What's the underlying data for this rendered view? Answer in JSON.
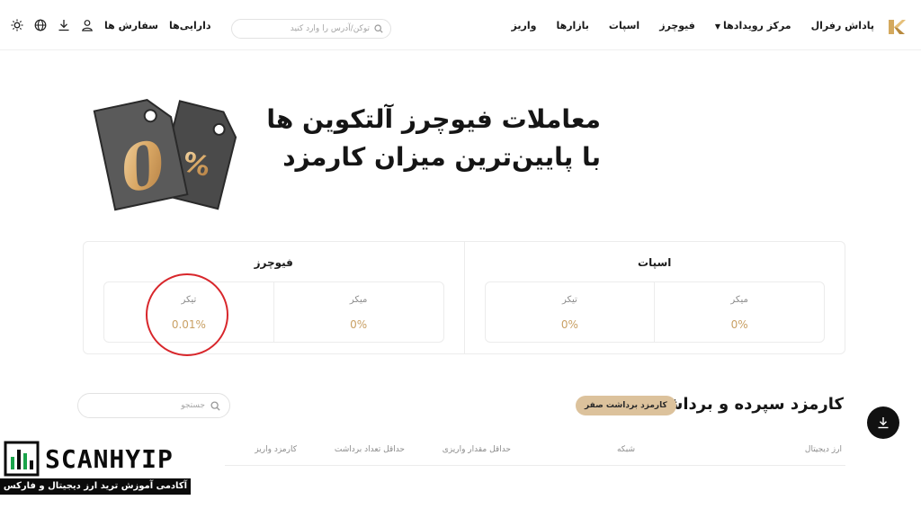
{
  "header": {
    "logo_icon": "kcex-logo-icon",
    "nav": {
      "deposit": "واریز",
      "markets": "بازارها",
      "spot": "اسپات",
      "futures": "فیوچرز",
      "events": "مرکز رویدادها",
      "referral": "پاداش رفرال"
    },
    "search_placeholder": "توکن/آدرس را وارد کنید",
    "assets": "دارایی‌ها",
    "orders": "سفارش ها",
    "icons": [
      "user-icon",
      "download-icon",
      "globe-icon",
      "theme-icon"
    ]
  },
  "hero": {
    "title_line1": "معاملات فیوچرز آلتکوین ها",
    "title_line2": "با پایین‌ترین میزان کارمزد",
    "art_zero": "0",
    "art_percent": "%"
  },
  "fees": {
    "spot": {
      "title": "اسپات",
      "maker_label": "میکر",
      "maker_value": "0%",
      "taker_label": "تیکر",
      "taker_value": "0%"
    },
    "futures": {
      "title": "فیوچرز",
      "maker_label": "میکر",
      "maker_value": "0%",
      "taker_label": "تیکر",
      "taker_value": "0.01%"
    }
  },
  "deposit_withdraw": {
    "title": "کارمزد سپرده و برداشت",
    "badge": "کارمزد برداشت صفر",
    "search_placeholder": "جستجو",
    "columns": [
      "ارز دیجیتال",
      "شبکه",
      "حداقل مقدار واریزی",
      "حداقل تعداد برداشت",
      "کارمزد واریز"
    ]
  },
  "watermark": {
    "name": "SCANHYIP",
    "tagline": "آکادمی آموزش ترید ارز دیجیتال و فارکس"
  },
  "colors": {
    "accent_gold": "#c9a064",
    "badge_bg": "#dcc29c",
    "highlight_circle": "#d8262b"
  }
}
